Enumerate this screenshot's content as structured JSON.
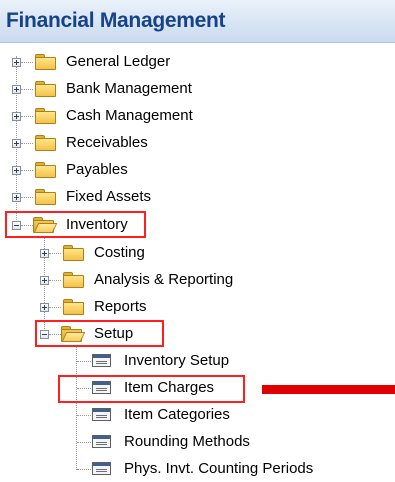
{
  "header": {
    "title": "Financial Management"
  },
  "tree": {
    "top_items": [
      {
        "label": "General Ledger"
      },
      {
        "label": "Bank Management"
      },
      {
        "label": "Cash Management"
      },
      {
        "label": "Receivables"
      },
      {
        "label": "Payables"
      },
      {
        "label": "Fixed Assets"
      },
      {
        "label": "Inventory"
      }
    ],
    "inventory_children": [
      {
        "label": "Costing"
      },
      {
        "label": "Analysis & Reporting"
      },
      {
        "label": "Reports"
      },
      {
        "label": "Setup"
      }
    ],
    "setup_children": [
      {
        "label": "Inventory Setup"
      },
      {
        "label": "Item Charges"
      },
      {
        "label": "Item Categories"
      },
      {
        "label": "Rounding Methods"
      },
      {
        "label": "Phys. Invt. Counting Periods"
      }
    ]
  },
  "annotation": {
    "highlight_color": "#ff1f1f",
    "arrow_color": "#e00000"
  }
}
